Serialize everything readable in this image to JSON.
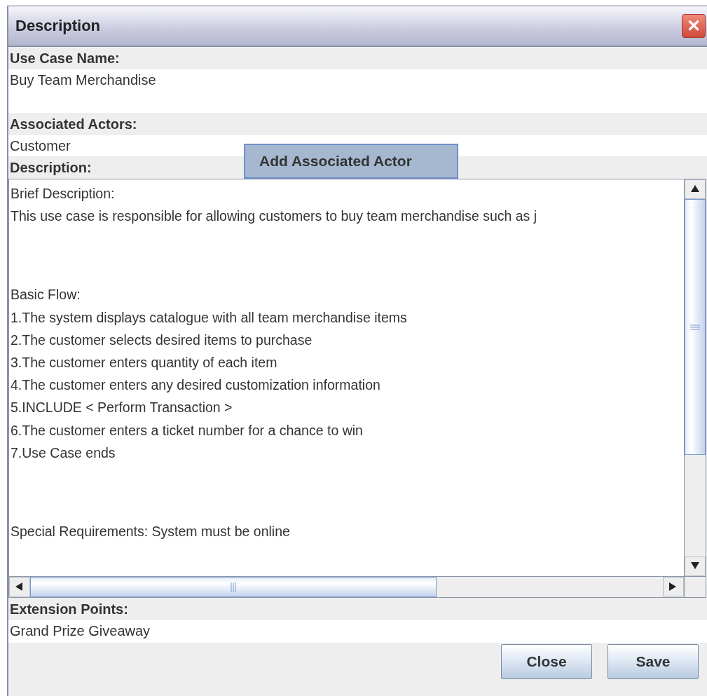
{
  "window": {
    "title": "Description",
    "close": "✕"
  },
  "fields": [
    {
      "label": "Use Case Name:",
      "value": "Buy Team Merchandise",
      "kind": "tall"
    },
    {
      "label": "Associated Actors:",
      "value": "Customer",
      "kind": "short"
    }
  ],
  "add_actor_button": "Add Associated Actor",
  "description": {
    "label": "Description:",
    "paragraphs": [
      [
        "Brief Description:",
        "This use case is responsible for allowing customers to buy team merchandise such as j"
      ],
      [
        "Basic Flow:",
        "1.The system displays catalogue with all team merchandise items",
        "2.The customer selects desired items to purchase",
        "3.The customer enters quantity of each item",
        "4.The customer enters any desired customization information",
        "5.INCLUDE < Perform Transaction >",
        "6.The customer enters a ticket number for a chance to win",
        "7.Use Case ends"
      ],
      [
        "Special Requirements: System must be online"
      ]
    ]
  },
  "extension": {
    "label": "Extension Points:",
    "value": "Grand Prize Giveaway"
  },
  "buttons": [
    "Close",
    "Save"
  ]
}
